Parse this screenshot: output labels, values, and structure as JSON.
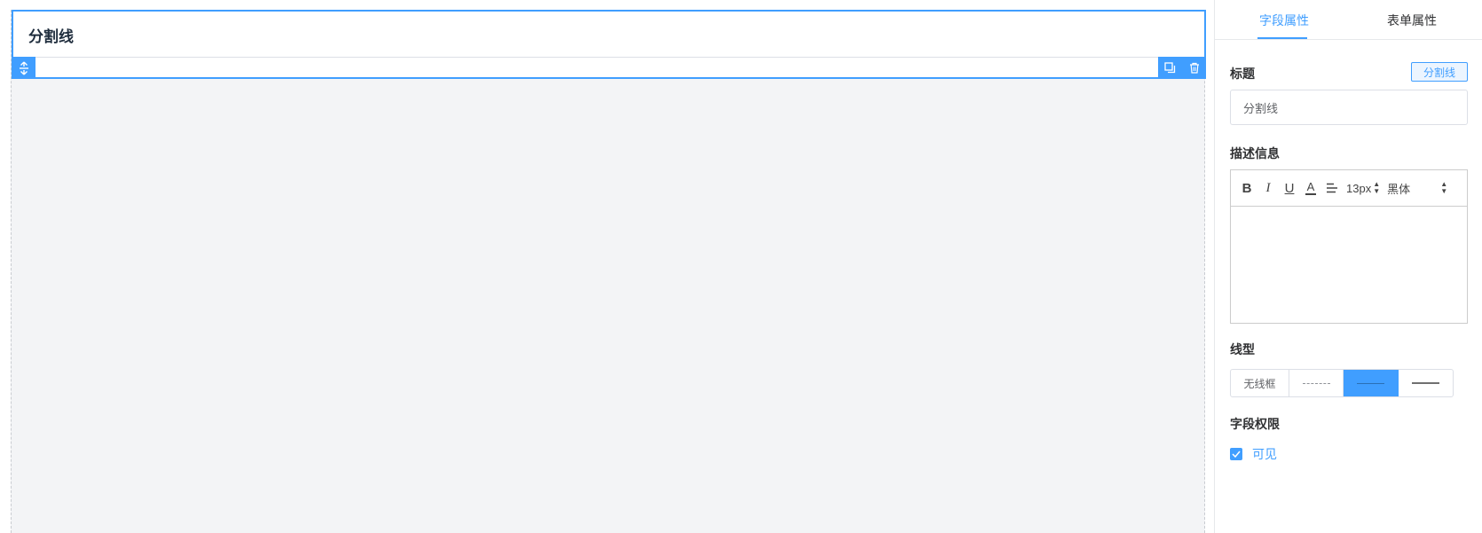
{
  "canvas": {
    "field_title": "分割线"
  },
  "panel": {
    "tabs": [
      {
        "label": "字段属性",
        "active": true
      },
      {
        "label": "表单属性",
        "active": false
      }
    ],
    "title_label": "标题",
    "field_type_tag": "分割线",
    "title_value": "分割线",
    "description_label": "描述信息",
    "editor": {
      "bold": "B",
      "italic": "I",
      "underline": "U",
      "font_color": "A",
      "font_size": "13px",
      "font_family": "黑体"
    },
    "line_type_label": "线型",
    "line_types": [
      {
        "label": "无线框",
        "active": false
      },
      {
        "label": "",
        "style": "dashed",
        "active": false
      },
      {
        "label": "",
        "style": "solid-thin",
        "active": true
      },
      {
        "label": "",
        "style": "solid-thick",
        "active": false
      }
    ],
    "permission_label": "字段权限",
    "visible_label": "可见",
    "visible_checked": true
  },
  "colors": {
    "accent": "#409eff",
    "canvas_bg": "#f3f4f6"
  }
}
